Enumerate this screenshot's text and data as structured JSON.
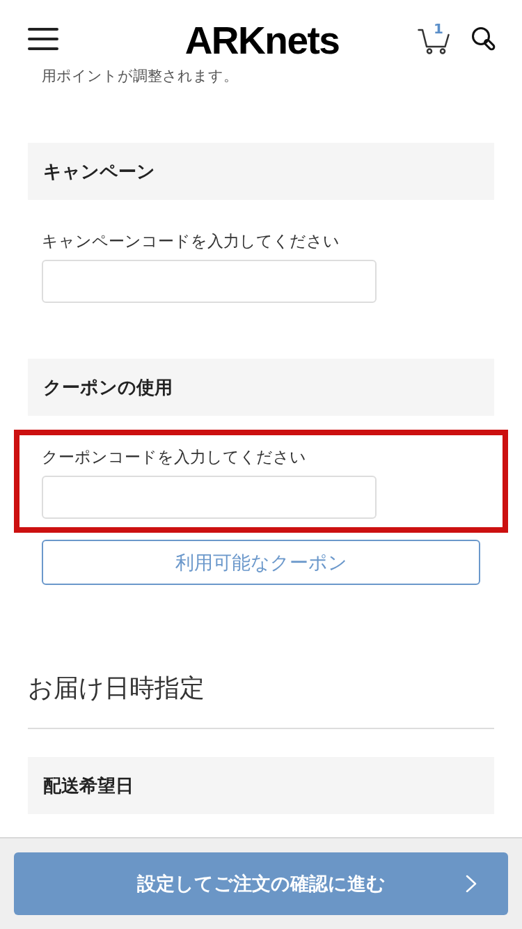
{
  "header": {
    "logo": "ARKnets",
    "cart_count": "1"
  },
  "notice": "用ポイントが調整されます。",
  "sections": [
    {
      "heading": "キャンペーン",
      "label": "キャンペーンコードを入力してください",
      "highlighted": false
    },
    {
      "heading": "クーポンの使用",
      "label": "クーポンコードを入力してください",
      "highlighted": true,
      "button": "利用可能なクーポン"
    }
  ],
  "delivery": {
    "title": "お届け日時指定",
    "sections": [
      {
        "heading": "配送希望日"
      }
    ]
  },
  "footer": {
    "button": "設定してご注文の確認に進む"
  }
}
